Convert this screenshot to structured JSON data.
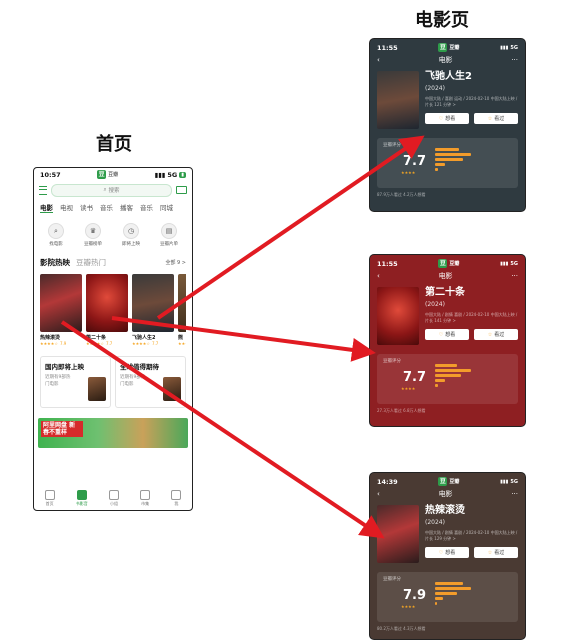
{
  "labels": {
    "home": "首页",
    "movie_page": "电影页"
  },
  "phone": {
    "status": {
      "time": "10:57",
      "app": "豆瓣",
      "network": "5G",
      "battery": "5G"
    },
    "search_placeholder": "搜索",
    "tabs": [
      "电影",
      "电视",
      "读书",
      "音乐",
      "播客",
      "音乐",
      "同城"
    ],
    "quick": [
      "找电影",
      "豆瓣榜单",
      "即将上映",
      "豆瓣片单"
    ],
    "section": {
      "main": "影院热映",
      "alt": "豆瓣热门",
      "all": "全部 9 >"
    },
    "posters": [
      {
        "title": "热辣滚烫",
        "stars": "★★★★☆",
        "score": "7.9"
      },
      {
        "title": "第二十条",
        "stars": "★★★★☆",
        "score": "7.7"
      },
      {
        "title": "飞驰人生2",
        "stars": "★★★★☆",
        "score": "7.7"
      },
      {
        "title": "熊",
        "stars": "★★★",
        "score": ""
      }
    ],
    "cards": [
      {
        "title": "国内即将上映",
        "sub": "近期有9部热门电影"
      },
      {
        "title": "全球值得期待",
        "sub": "近期有9部热门电影"
      }
    ],
    "banner": "阿里网盘 新春不重样",
    "nav": [
      "首页",
      "书影音",
      "小组",
      "市集",
      "我"
    ]
  },
  "screens": [
    {
      "time": "11:55",
      "app": "豆瓣",
      "network": "5G",
      "nav_title": "电影",
      "title": "飞驰人生2",
      "year": "(2024)",
      "meta": "中国大陆 / 喜剧 运动 / 2024-02-10 中国大陆上映 / 片长 121 分钟 >",
      "btn_want": "想看",
      "btn_seen": "看过",
      "rating_label": "豆瓣评分",
      "score": "7.7",
      "stars": "★★★★",
      "foot": "87.9万人看过  4.2万人想看"
    },
    {
      "time": "11:55",
      "app": "豆瓣",
      "network": "5G",
      "nav_title": "电影",
      "title": "第二十条",
      "year": "(2024)",
      "meta": "中国大陆 / 剧情 喜剧 / 2024-02-10 中国大陆上映 / 片长 141 分钟 >",
      "btn_want": "想看",
      "btn_seen": "看过",
      "rating_label": "豆瓣评分",
      "score": "7.7",
      "stars": "★★★★",
      "foot": "27.3万人看过  6.8万人想看"
    },
    {
      "time": "14:39",
      "app": "豆瓣",
      "network": "5G",
      "nav_title": "电影",
      "title": "热辣滚烫",
      "year": "(2024)",
      "meta": "中国大陆 / 剧情 喜剧 / 2024-02-10 中国大陆上映 / 片长 129 分钟 >",
      "btn_want": "想看",
      "btn_seen": "看过",
      "rating_label": "豆瓣评分",
      "score": "7.9",
      "stars": "★★★★",
      "foot": "80.2万人看过  4.3万人想看"
    }
  ],
  "colors": {
    "douban_green": "#2e9c4a",
    "arrow_red": "#e11b22",
    "star": "#f5a623"
  }
}
